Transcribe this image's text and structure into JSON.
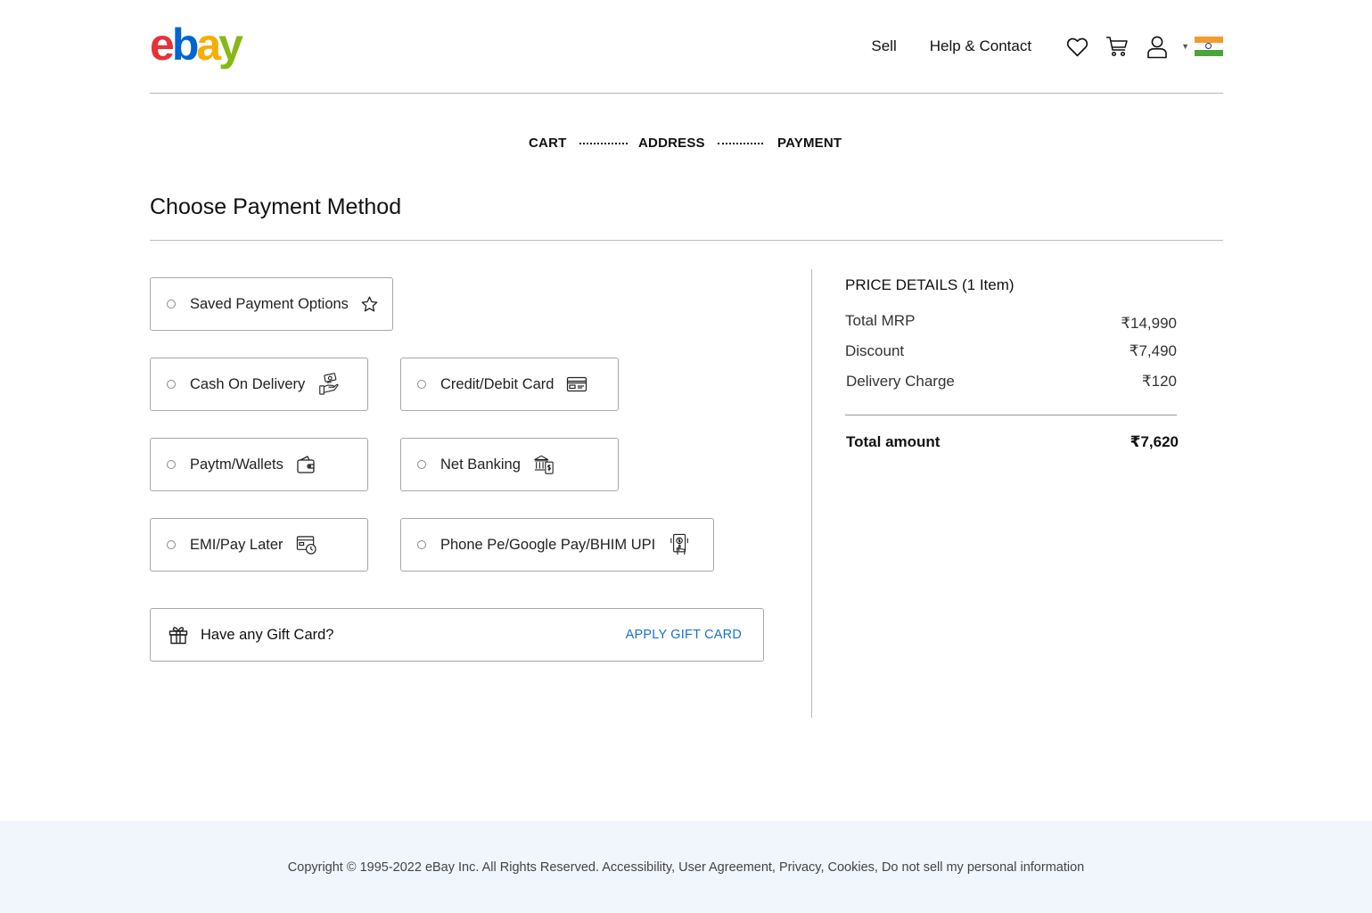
{
  "header": {
    "logo_letters": [
      "e",
      "b",
      "a",
      "y"
    ],
    "logo_colors": [
      "#e53238",
      "#0064d2",
      "#f5af02",
      "#86b817"
    ],
    "nav": {
      "sell": "Sell",
      "help": "Help & Contact"
    },
    "icons": [
      "heart-icon",
      "cart-icon",
      "user-icon",
      "india-flag-icon"
    ],
    "caret": "▼"
  },
  "steps": {
    "cart": "CART",
    "address": "ADDRESS",
    "payment": "PAYMENT"
  },
  "page_title": "Choose Payment Method",
  "payment_options": {
    "saved": "Saved Payment Options",
    "cod": "Cash On Delivery",
    "card": "Credit/Debit Card",
    "wallets": "Paytm/Wallets",
    "netbanking": "Net Banking",
    "emi": "EMI/Pay Later",
    "upi": "Phone Pe/Google Pay/BHIM UPI"
  },
  "gift_card": {
    "label": "Have any Gift Card?",
    "action": "APPLY GIFT CARD"
  },
  "price_details": {
    "title": "PRICE DETAILS (1 Item)",
    "rows": [
      {
        "label": "Total MRP",
        "value": "₹14,990"
      },
      {
        "label": "Discount",
        "value": "₹7,490"
      },
      {
        "label": "Delivery Charge",
        "value": "₹120"
      }
    ],
    "total_label": "Total amount",
    "total_value": "₹7,620"
  },
  "footer": {
    "text": "Copyright © 1995-2022 eBay Inc. All Rights Reserved. Accessibility, User Agreement, Privacy, Cookies, Do not sell my personal information"
  },
  "colors": {
    "accent_link": "#1a6fd0",
    "footer_bg": "#f1f5fc",
    "flag_saffron": "#f59b2b",
    "flag_green": "#4ea23a"
  }
}
